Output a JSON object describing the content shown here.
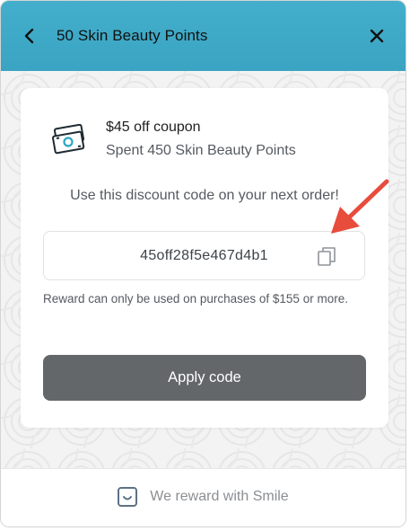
{
  "header": {
    "title": "50 Skin Beauty Points",
    "background": "#3fabc8"
  },
  "reward": {
    "title": "$45 off coupon",
    "subtitle": "Spent 450 Skin Beauty Points",
    "icon": "coupon-bill-icon"
  },
  "instructions": "Use this discount code on your next order!",
  "code": {
    "value": "45off28f5e467d4b1",
    "copy_icon": "copy-icon"
  },
  "notice": "Reward can only be used on purchases of $155 or more.",
  "apply_button": {
    "label": "Apply code",
    "color": "#636769"
  },
  "footer": {
    "label": "We reward with Smile",
    "icon": "smile-logo-icon"
  },
  "annotation": {
    "arrow_color": "#e74c3c"
  }
}
